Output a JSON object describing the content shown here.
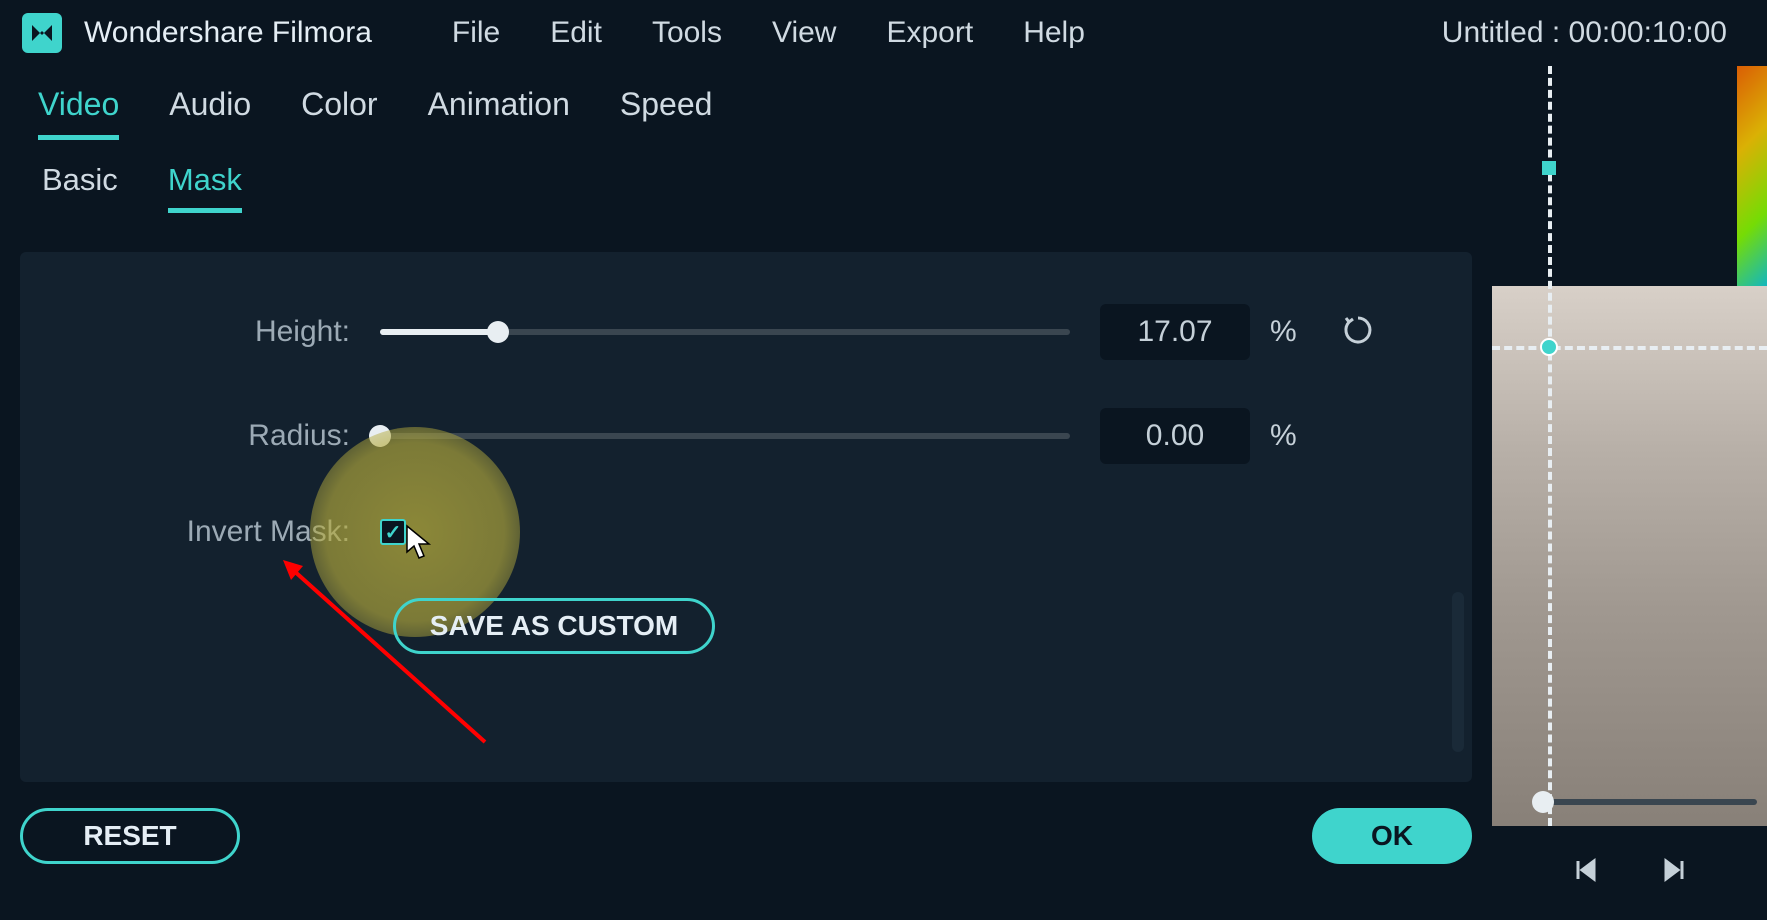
{
  "app": {
    "name": "Wondershare Filmora",
    "project_title": "Untitled : 00:00:10:00"
  },
  "menubar": {
    "items": [
      "File",
      "Edit",
      "Tools",
      "View",
      "Export",
      "Help"
    ]
  },
  "main_tabs": {
    "items": [
      "Video",
      "Audio",
      "Color",
      "Animation",
      "Speed"
    ],
    "active": 0
  },
  "sub_tabs": {
    "items": [
      "Basic",
      "Mask"
    ],
    "active": 1
  },
  "controls": {
    "height": {
      "label": "Height:",
      "value": "17.07",
      "unit": "%",
      "slider_pct": 17.07
    },
    "radius": {
      "label": "Radius:",
      "value": "0.00",
      "unit": "%",
      "slider_pct": 0
    },
    "invert_mask": {
      "label": "Invert Mask:",
      "checked": true
    },
    "save_custom_label": "SAVE AS CUSTOM"
  },
  "footer": {
    "reset_label": "RESET",
    "ok_label": "OK"
  }
}
